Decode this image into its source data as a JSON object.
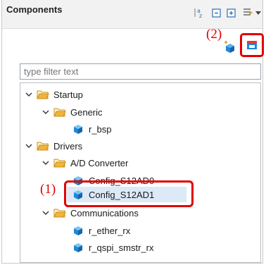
{
  "header": {
    "title": "Components"
  },
  "annotations": {
    "label_2": "(2)",
    "label_1": "(1)"
  },
  "filter": {
    "placeholder": "type filter text"
  },
  "tree": {
    "startup": "Startup",
    "generic": "Generic",
    "r_bsp": "r_bsp",
    "drivers": "Drivers",
    "ad_converter": "A/D Converter",
    "config0": "Config_S12AD0",
    "config1": "Config_S12AD1",
    "communications": "Communications",
    "r_ether_rx": "r_ether_rx",
    "r_qspi": "r_qspi_smstr_rx"
  },
  "icons": {
    "sort": "sort-alpha-icon",
    "collapse": "collapse-all-icon",
    "expand": "expand-all-icon",
    "filter": "filter-icon",
    "menu": "view-menu-icon",
    "add": "add-component-icon",
    "new": "new-component-icon",
    "folder": "folder-icon",
    "component": "component-cube-icon"
  },
  "colors": {
    "accent": "#e00000",
    "folder": "#f2b33d",
    "cube": "#1e88d8"
  }
}
